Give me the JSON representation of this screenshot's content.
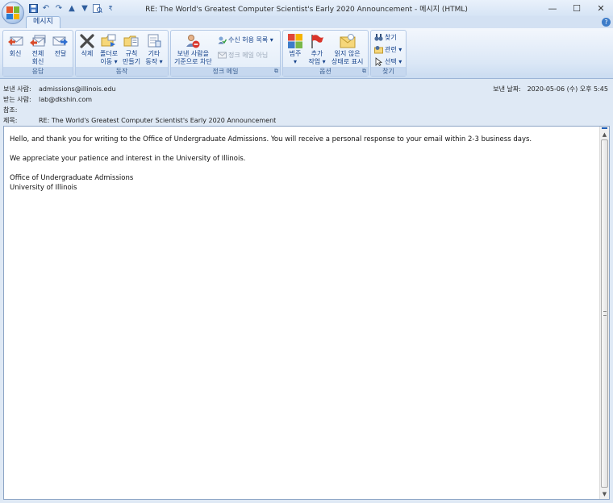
{
  "window": {
    "title": "RE: The World's Greatest Computer Scientist's Early 2020 Announcement - 메시지 (HTML)",
    "minimize": "—",
    "maximize": "☐",
    "close": "✕"
  },
  "ribbon": {
    "tab_label": "메시지",
    "help": "?",
    "groups": {
      "respond": {
        "label": "응답",
        "reply": "회신",
        "reply_all_l1": "전체",
        "reply_all_l2": "회신",
        "forward": "전달"
      },
      "actions": {
        "label": "동작",
        "delete": "삭제",
        "move_l1": "폴더로",
        "move_l2": "이동 ▾",
        "rules_l1": "규칙",
        "rules_l2": "만들기",
        "other_l1": "기타",
        "other_l2": "동작 ▾"
      },
      "junk": {
        "label": "정크 메일",
        "block_l1": "보낸 사람을",
        "block_l2": "기준으로 차단",
        "safe_list": "수신 허용 목록 ▾",
        "not_junk": "정크 메일 아님"
      },
      "options": {
        "label": "옵션",
        "categorize_l1": "범주",
        "categorize_l2": "▾",
        "followup_l1": "추가",
        "followup_l2": "작업 ▾",
        "unread_l1": "읽지 않은",
        "unread_l2": "상태로 표시"
      },
      "find": {
        "label": "찾기",
        "find": "찾기",
        "related": "관련 ▾",
        "select": "선택 ▾"
      }
    }
  },
  "header": {
    "from_label": "보낸 사람:",
    "from": "admissions@illinois.edu",
    "to_label": "받는 사람:",
    "to": "lab@dkshin.com",
    "cc_label": "참조:",
    "cc": "",
    "subject_label": "제목:",
    "subject": "RE: The World's Greatest Computer Scientist's Early 2020 Announcement",
    "sent_label": "보낸 날짜:",
    "sent": "2020-05-06 (수) 오후 5:45"
  },
  "message": {
    "para1": "Hello, and thank you for writing to the Office of Undergraduate Admissions. You will receive a personal response to your email within 2-3 business days.",
    "para2": "We appreciate your patience and interest in the University of Illinois.",
    "sig1": "Office of Undergraduate Admissions",
    "sig2": "University of Illinois"
  },
  "icons": {
    "orb": "office-button-icon",
    "save": "save-icon",
    "undo": "undo-icon",
    "redo": "redo-icon",
    "prev": "previous-item-icon",
    "next": "next-item-icon",
    "print": "print-preview-icon"
  },
  "colors": {
    "ribbon_text": "#15428b",
    "frame_border": "#8da5c6",
    "background": "#dfe9f5"
  }
}
